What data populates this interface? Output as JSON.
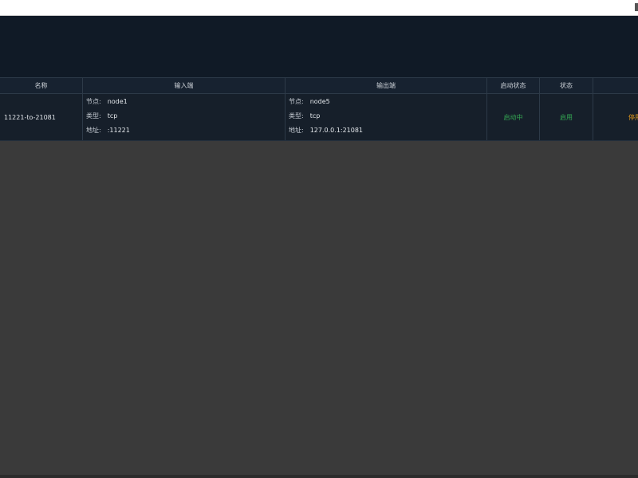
{
  "icons": {
    "window_edge": "scroll-indicator-icon"
  },
  "colors": {
    "banner_bg": "#101a26",
    "table_bg": "#161f2a",
    "status_green": "#34a853",
    "action_orange": "#e39a1c",
    "page_bg": "#3a3a3a"
  },
  "table": {
    "headers": [
      "名称",
      "输入端",
      "输出端",
      "启动状态",
      "状态",
      ""
    ],
    "rows": [
      {
        "name": "11221-to-21081",
        "input": {
          "node_label": "节点:",
          "node": "node1",
          "type_label": "类型:",
          "type": "tcp",
          "addr_label": "地址:",
          "addr": ":11221"
        },
        "output": {
          "node_label": "节点:",
          "node": "node5",
          "type_label": "类型:",
          "type": "tcp",
          "addr_label": "地址:",
          "addr": "127.0.0.1:21081"
        },
        "start_status": "启动中",
        "status": "启用",
        "action": "停用"
      }
    ]
  }
}
